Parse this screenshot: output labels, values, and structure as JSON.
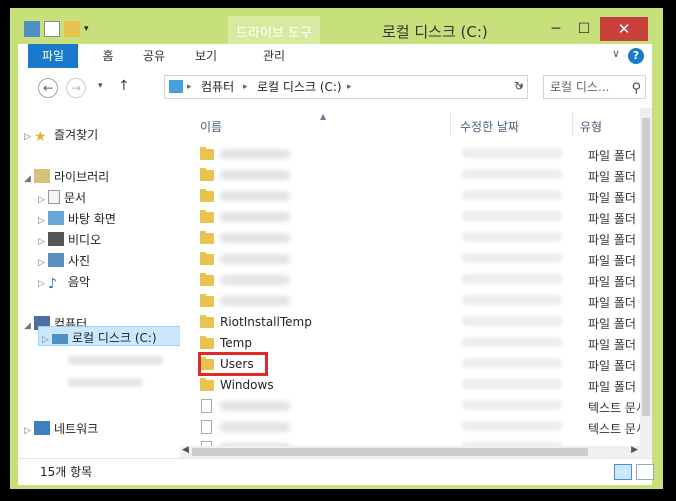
{
  "window": {
    "title": "로컬 디스크 (C:)",
    "contextual_tab": "드라이브 도구",
    "minimize": "─",
    "maximize": "☐",
    "close": "✕",
    "accent": "#c8e07c",
    "close_color": "#c7403b"
  },
  "ribbon": {
    "tabs": [
      "파일",
      "홈",
      "공유",
      "보기",
      "관리"
    ],
    "help": "?",
    "toggle": "∨"
  },
  "navigation": {
    "breadcrumb": [
      "컴퓨터",
      "로컬 디스크 (C:)"
    ],
    "search_placeholder": "로컬 디스..."
  },
  "nav_pane": {
    "favorites": "즐겨찾기",
    "libraries": "라이브러리",
    "library_items": [
      "문서",
      "바탕 화면",
      "비디오",
      "사진",
      "음악"
    ],
    "computer": "컴퓨터",
    "local_disk": "로컬 디스크 (C:)",
    "network": "네트워크"
  },
  "columns": {
    "name": "이름",
    "date": "수정한 날짜",
    "type": "유형"
  },
  "files": [
    {
      "name": "",
      "type": "파일 폴더",
      "kind": "folder"
    },
    {
      "name": "",
      "type": "파일 폴더",
      "kind": "folder"
    },
    {
      "name": "",
      "type": "파일 폴더",
      "kind": "folder"
    },
    {
      "name": "",
      "type": "파일 폴더",
      "kind": "folder"
    },
    {
      "name": "",
      "type": "파일 폴더",
      "kind": "folder"
    },
    {
      "name": "",
      "type": "파일 폴더",
      "kind": "folder"
    },
    {
      "name": "",
      "type": "파일 폴더",
      "kind": "folder"
    },
    {
      "name": "",
      "type": "파일 폴더",
      "kind": "folder"
    },
    {
      "name": "RiotInstallTemp",
      "type": "파일 폴더",
      "kind": "folder"
    },
    {
      "name": "Temp",
      "type": "파일 폴더",
      "kind": "folder"
    },
    {
      "name": "Users",
      "type": "파일 폴더",
      "kind": "folder"
    },
    {
      "name": "Windows",
      "type": "파일 폴더",
      "kind": "folder"
    },
    {
      "name": "",
      "type": "텍스트 문서",
      "kind": "doc"
    },
    {
      "name": "",
      "type": "텍스트 문서",
      "kind": "doc"
    },
    {
      "name": "",
      "type": "",
      "kind": "doc"
    }
  ],
  "status": {
    "count": "15개 항목"
  }
}
